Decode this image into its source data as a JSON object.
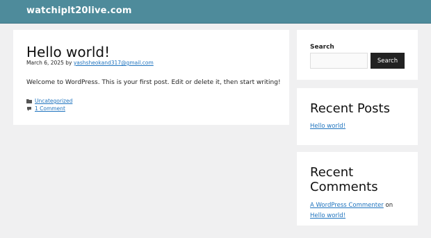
{
  "header": {
    "site_title": "watchiplt20live.com",
    "background": "#4e8b9b"
  },
  "post": {
    "title": "Hello world!",
    "date": "March 6, 2025",
    "by": "by",
    "author": "yashsheokand317@gmail.com",
    "content": "Welcome to WordPress. This is your first post. Edit or delete it, then start writing!",
    "category": "Uncategorized",
    "comments": "1 Comment",
    "category_icon": "folder-icon",
    "comments_icon": "comment-icon"
  },
  "sidebar": {
    "search": {
      "label": "Search",
      "button_label": "Search",
      "placeholder": ""
    },
    "recent_posts": {
      "title": "Recent Posts",
      "items": [
        "Hello world!"
      ]
    },
    "recent_comments": {
      "title": "Recent Comments",
      "commenter": "A WordPress Commenter",
      "on": "on",
      "post": "Hello world!"
    }
  },
  "colors": {
    "link": "#1e73be",
    "page_background": "#f0f0f1",
    "button": "#222222"
  }
}
